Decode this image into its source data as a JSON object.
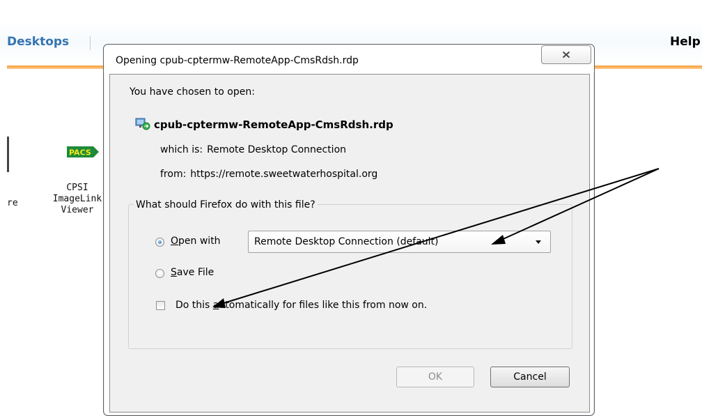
{
  "background_page": {
    "nav_desktops": "Desktops",
    "nav_help": "Help",
    "app_partial_label": "re",
    "pacs_icon_text": "PACS",
    "app_cpsi_label": "CPSI\nImageLink\nViewer"
  },
  "dialog": {
    "title": "Opening cpub-cptermw-RemoteApp-CmsRdsh.rdp",
    "close_icon": "close-x-icon",
    "chosen_label": "You have chosen to open:",
    "file_icon": "remote-desktop-file-icon",
    "file_name": "cpub-cptermw-RemoteApp-CmsRdsh.rdp",
    "which_is_label": "which is:",
    "which_is_value": "Remote Desktop Connection",
    "from_label": "from:",
    "from_value": "https://remote.sweetwaterhospital.org",
    "group_label": "What should Firefox do with this file?",
    "open_with": {
      "accel": "O",
      "rest": "pen with",
      "checked": true
    },
    "open_with_app": "Remote Desktop Connection (default)",
    "save_file": {
      "accel": "S",
      "rest": "ave File",
      "checked": false
    },
    "auto_checkbox": {
      "before": "Do this ",
      "accel": "a",
      "after": "utomatically for files like this from now on.",
      "checked": false
    },
    "ok_label": "OK",
    "cancel_label": "Cancel"
  },
  "colors": {
    "nav_link": "#3474b0",
    "nav_accent_line": "#f7a033",
    "pacs_green": "#1e8b3a",
    "pacs_yellow": "#f5e71a",
    "annotation_arrow": "#000000"
  }
}
